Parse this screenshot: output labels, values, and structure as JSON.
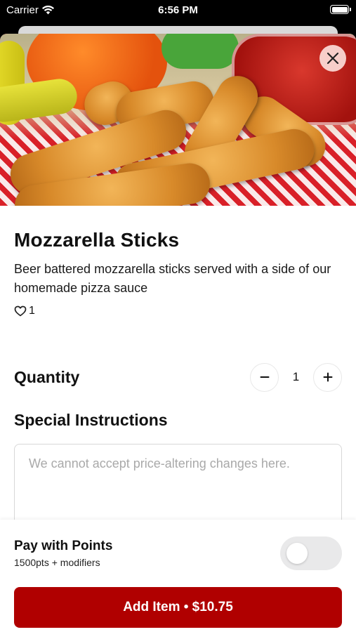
{
  "status_bar": {
    "carrier": "Carrier",
    "time": "6:56 PM",
    "wifi_icon": "wifi-icon",
    "battery_icon": "battery-icon"
  },
  "item": {
    "title": "Mozzarella Sticks",
    "description": "Beer battered mozzarella sticks served with a side of our homemade pizza sauce",
    "likes": "1",
    "like_icon": "heart-icon",
    "close_icon": "close-icon"
  },
  "quantity": {
    "label": "Quantity",
    "value": "1",
    "minus_icon": "minus-icon",
    "plus_icon": "plus-icon"
  },
  "special_instructions": {
    "label": "Special Instructions",
    "placeholder": "We cannot accept price-altering changes here.",
    "value": ""
  },
  "points": {
    "title": "Pay with Points",
    "subtitle": "1500pts + modifiers",
    "enabled": false
  },
  "add_button": {
    "label": "Add Item • $10.75"
  },
  "colors": {
    "accent": "#b00000",
    "toggle_off": "#e9e9ea"
  }
}
